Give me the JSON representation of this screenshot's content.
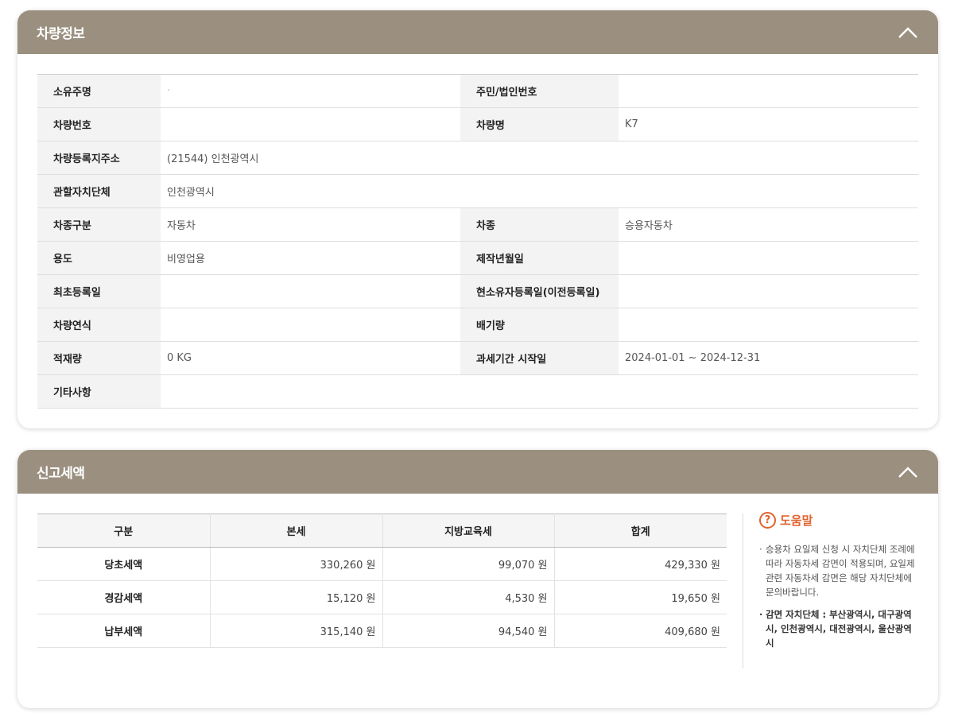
{
  "vehicle_panel": {
    "title": "차량정보",
    "rows": [
      {
        "l1": "소유주명",
        "v1": "·",
        "l2": "주민/법인번호",
        "v2": ""
      },
      {
        "l1": "차량번호",
        "v1": "",
        "l2": "차량명",
        "v2": "K7"
      },
      {
        "l1": "차량등록지주소",
        "v1": "(21544) 인천광역시"
      },
      {
        "l1": "관할자치단체",
        "v1": "인천광역시"
      },
      {
        "l1": "차종구분",
        "v1": "자동차",
        "l2": "차종",
        "v2": "승용자동차"
      },
      {
        "l1": "용도",
        "v1": "비영업용",
        "l2": "제작년월일",
        "v2": ""
      },
      {
        "l1": "최초등록일",
        "v1": "",
        "l2": "현소유자등록일(이전등록일)",
        "v2": ""
      },
      {
        "l1": "차량연식",
        "v1": "",
        "l2": "배기량",
        "v2": ""
      },
      {
        "l1": "적재량",
        "v1": "0 KG",
        "l2": "과세기간 시작일",
        "v2": "2024-01-01 ~ 2024-12-31"
      },
      {
        "l1": "기타사항",
        "v1": ""
      }
    ]
  },
  "tax_panel": {
    "title": "신고세액",
    "headers": [
      "구분",
      "본세",
      "지방교육세",
      "합계"
    ],
    "rows": [
      {
        "label": "당초세액",
        "base": "330,260 원",
        "edu": "99,070 원",
        "total": "429,330 원"
      },
      {
        "label": "경감세액",
        "base": "15,120 원",
        "edu": "4,530 원",
        "total": "19,650 원"
      },
      {
        "label": "납부세액",
        "base": "315,140 원",
        "edu": "94,540 원",
        "total": "409,680 원"
      }
    ],
    "help": {
      "title": "도움말",
      "icon": "question-circle-icon",
      "item1": "승용차 요일제 신청 시 자치단체 조례에 따라 자동차세 감면이 적용되며, 요일제 관련 자동차세 감면은 해당 자치단체에 문의바랍니다.",
      "item2": "감면 자치단체 : 부산광역시, 대구광역시, 인천광역시, 대전광역시, 울산광역시"
    }
  },
  "colors": {
    "header_bg": "#9b9080",
    "help_accent": "#e0622f",
    "label_bg": "#f3f3f3"
  }
}
